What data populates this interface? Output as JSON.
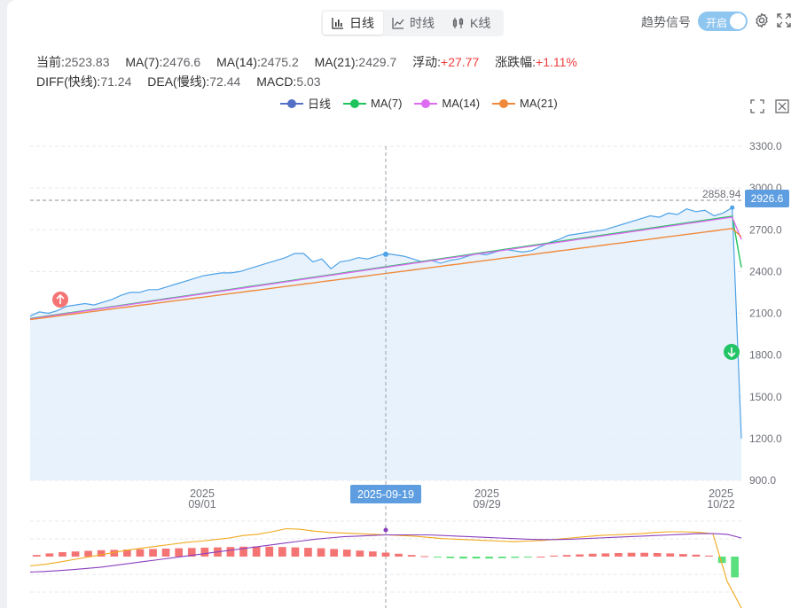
{
  "tabs": [
    {
      "label": "日线",
      "icon": "bar-chart-icon",
      "active": true
    },
    {
      "label": "时线",
      "icon": "line-chart-icon",
      "active": false
    },
    {
      "label": "K线",
      "icon": "candlestick-icon",
      "active": false
    }
  ],
  "trend_signal": {
    "label": "趋势信号",
    "toggle_label": "开启",
    "enabled": true
  },
  "stats": {
    "current_label": "当前:",
    "current_value": "2523.83",
    "ma7_label": "MA(7):",
    "ma7_value": "2476.6",
    "ma14_label": "MA(14):",
    "ma14_value": "2475.2",
    "ma21_label": "MA(21):",
    "ma21_value": "2429.7",
    "float_label": "浮动:",
    "float_value": "+27.77",
    "change_label": "涨跌幅:",
    "change_value": "+1.11%",
    "diff_label": "DIFF(快线):",
    "diff_value": "71.24",
    "dea_label": "DEA(慢线):",
    "dea_value": "72.44",
    "macd_label": "MACD:",
    "macd_value": "5.03"
  },
  "colors": {
    "daily": "#5470c6",
    "ma7": "#1ec35c",
    "ma14": "#dd6bf0",
    "ma21": "#f08a3a",
    "area_fill": "#e4f0fd",
    "daily_line": "#4ea2e6",
    "up": "#f47474",
    "down": "#5ce07e",
    "diff": "#f0a81c",
    "dea": "#8a3fc0",
    "axis_text": "#6e7079",
    "highlight_label": "#5e9ee0"
  },
  "chart_data": {
    "type": "line",
    "title": "",
    "series": [
      {
        "name": "日线",
        "values": [
          2080,
          2110,
          2100,
          2120,
          2150,
          2160,
          2170,
          2160,
          2180,
          2200,
          2230,
          2250,
          2250,
          2270,
          2270,
          2290,
          2310,
          2330,
          2350,
          2370,
          2380,
          2390,
          2390,
          2400,
          2420,
          2440,
          2460,
          2480,
          2500,
          2530,
          2530,
          2470,
          2490,
          2420,
          2470,
          2480,
          2500,
          2490,
          2510,
          2530,
          2520,
          2510,
          2490,
          2470,
          2480,
          2460,
          2480,
          2490,
          2510,
          2530,
          2520,
          2540,
          2560,
          2550,
          2540,
          2550,
          2580,
          2610,
          2630,
          2660,
          2670,
          2680,
          2690,
          2700,
          2720,
          2740,
          2760,
          2780,
          2800,
          2790,
          2820,
          2810,
          2850,
          2830,
          2840,
          2800,
          2820,
          2859,
          1200
        ]
      },
      {
        "name": "MA(7)",
        "values": [
          2063,
          2072,
          2082,
          2091,
          2101,
          2110,
          2120,
          2129,
          2139,
          2148,
          2158,
          2167,
          2177,
          2186,
          2196,
          2206,
          2215,
          2225,
          2234,
          2244,
          2253,
          2263,
          2272,
          2282,
          2292,
          2301,
          2311,
          2320,
          2330,
          2339,
          2349,
          2358,
          2368,
          2377,
          2387,
          2397,
          2406,
          2416,
          2425,
          2435,
          2444,
          2454,
          2463,
          2473,
          2482,
          2492,
          2501,
          2511,
          2521,
          2530,
          2540,
          2549,
          2559,
          2568,
          2578,
          2587,
          2597,
          2607,
          2616,
          2626,
          2635,
          2645,
          2654,
          2664,
          2673,
          2683,
          2692,
          2702,
          2712,
          2721,
          2731,
          2740,
          2750,
          2759,
          2769,
          2778,
          2788,
          2797,
          2430
        ]
      },
      {
        "name": "MA(14)",
        "values": [
          2060,
          2069,
          2079,
          2088,
          2098,
          2107,
          2117,
          2126,
          2136,
          2145,
          2155,
          2164,
          2174,
          2183,
          2193,
          2202,
          2212,
          2221,
          2231,
          2240,
          2250,
          2259,
          2269,
          2278,
          2288,
          2297,
          2307,
          2316,
          2326,
          2335,
          2345,
          2354,
          2364,
          2373,
          2383,
          2392,
          2402,
          2411,
          2421,
          2430,
          2440,
          2449,
          2459,
          2468,
          2478,
          2487,
          2497,
          2506,
          2516,
          2525,
          2535,
          2544,
          2554,
          2563,
          2573,
          2582,
          2592,
          2601,
          2611,
          2620,
          2630,
          2639,
          2649,
          2658,
          2668,
          2677,
          2687,
          2696,
          2706,
          2715,
          2725,
          2734,
          2744,
          2753,
          2763,
          2772,
          2782,
          2791,
          2630
        ]
      },
      {
        "name": "MA(21)",
        "values": [
          2055,
          2063,
          2072,
          2080,
          2089,
          2097,
          2106,
          2114,
          2123,
          2131,
          2140,
          2148,
          2157,
          2165,
          2174,
          2182,
          2191,
          2199,
          2208,
          2216,
          2225,
          2233,
          2242,
          2250,
          2259,
          2267,
          2276,
          2284,
          2293,
          2301,
          2310,
          2318,
          2327,
          2335,
          2344,
          2352,
          2361,
          2369,
          2378,
          2386,
          2395,
          2403,
          2412,
          2420,
          2429,
          2437,
          2446,
          2454,
          2463,
          2471,
          2480,
          2488,
          2497,
          2505,
          2514,
          2522,
          2531,
          2539,
          2548,
          2556,
          2565,
          2573,
          2582,
          2590,
          2599,
          2607,
          2616,
          2624,
          2633,
          2641,
          2650,
          2658,
          2667,
          2675,
          2684,
          2692,
          2701,
          2709,
          2650
        ]
      }
    ],
    "ylim": [
      900,
      3300
    ],
    "y_ticks": [
      "3300.0",
      "3000.0",
      "2700.0",
      "2400.0",
      "2100.0",
      "1800.0",
      "1500.0",
      "1200.0",
      "900.0"
    ],
    "x_ticks": [
      {
        "year": "2025",
        "date": "09/01"
      },
      {
        "year": "",
        "date": "2025-09-19"
      },
      {
        "year": "2025",
        "date": "09/29"
      },
      {
        "year": "2025",
        "date": "10/22"
      }
    ],
    "max_label": "2858.94",
    "current_marker": "2926.6",
    "signals": [
      "up",
      "down"
    ],
    "macd": {
      "bars": [
        10,
        20,
        28,
        32,
        36,
        40,
        42,
        44,
        46,
        48,
        50,
        52,
        54,
        56,
        58,
        60,
        62,
        64,
        62,
        60,
        58,
        55,
        52,
        48,
        44,
        38,
        32,
        25,
        18,
        10,
        3,
        -5,
        -10,
        -12,
        -12,
        -12,
        -10,
        -8,
        -5,
        0,
        6,
        10,
        14,
        18,
        20,
        22,
        24,
        24,
        22,
        20,
        16,
        12,
        6,
        -40,
        -130
      ],
      "diff": [
        -30,
        -25,
        -18,
        -10,
        -2,
        6,
        14,
        22,
        28,
        34,
        40,
        46,
        50,
        55,
        60,
        68,
        72,
        80,
        90,
        88,
        82,
        78,
        76,
        74,
        72,
        70,
        68,
        66,
        62,
        58,
        56,
        54,
        52,
        50,
        48,
        50,
        52,
        56,
        60,
        64,
        68,
        70,
        72,
        74,
        78,
        80,
        80,
        78,
        74,
        -80,
        -170
      ],
      "dea": [
        -50,
        -48,
        -45,
        -42,
        -38,
        -34,
        -28,
        -22,
        -16,
        -10,
        -4,
        2,
        8,
        14,
        20,
        26,
        32,
        38,
        44,
        50,
        56,
        60,
        64,
        66,
        68,
        70,
        70,
        70,
        70,
        68,
        66,
        64,
        62,
        60,
        58,
        56,
        55,
        55,
        56,
        58,
        60,
        62,
        64,
        66,
        68,
        70,
        72,
        74,
        74,
        72,
        60
      ]
    }
  }
}
